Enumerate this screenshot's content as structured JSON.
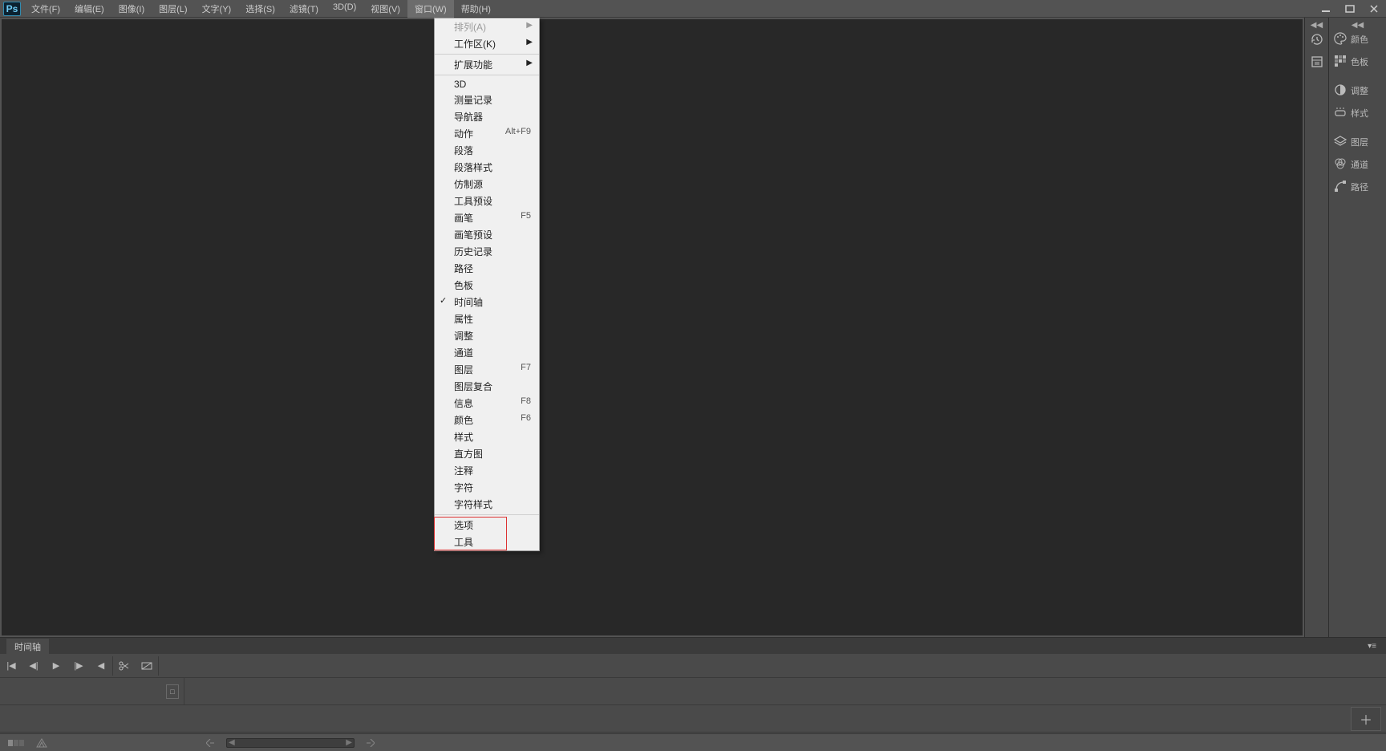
{
  "app": {
    "logo": "Ps"
  },
  "menu": {
    "items": [
      "文件(F)",
      "编辑(E)",
      "图像(I)",
      "图层(L)",
      "文字(Y)",
      "选择(S)",
      "滤镜(T)",
      "3D(D)",
      "视图(V)",
      "窗口(W)",
      "帮助(H)"
    ],
    "active_index": 9
  },
  "window_dropdown": {
    "sections": [
      [
        {
          "label": "排列(A)",
          "submenu": true,
          "disabled": true
        },
        {
          "label": "工作区(K)",
          "submenu": true
        }
      ],
      [
        {
          "label": "扩展功能",
          "submenu": true
        }
      ],
      [
        {
          "label": "3D"
        },
        {
          "label": "测量记录"
        },
        {
          "label": "导航器"
        },
        {
          "label": "动作",
          "shortcut": "Alt+F9"
        },
        {
          "label": "段落"
        },
        {
          "label": "段落样式"
        },
        {
          "label": "仿制源"
        },
        {
          "label": "工具预设"
        },
        {
          "label": "画笔",
          "shortcut": "F5"
        },
        {
          "label": "画笔预设"
        },
        {
          "label": "历史记录"
        },
        {
          "label": "路径"
        },
        {
          "label": "色板"
        },
        {
          "label": "时间轴",
          "checked": true
        },
        {
          "label": "属性"
        },
        {
          "label": "调整"
        },
        {
          "label": "通道"
        },
        {
          "label": "图层",
          "shortcut": "F7"
        },
        {
          "label": "图层复合"
        },
        {
          "label": "信息",
          "shortcut": "F8"
        },
        {
          "label": "颜色",
          "shortcut": "F6"
        },
        {
          "label": "样式"
        },
        {
          "label": "直方图"
        },
        {
          "label": "注释"
        },
        {
          "label": "字符"
        },
        {
          "label": "字符样式"
        }
      ],
      [
        {
          "label": "选项",
          "highlighted": true
        },
        {
          "label": "工具",
          "highlighted": true
        }
      ]
    ]
  },
  "right_panels": {
    "groups": [
      [
        {
          "name": "color",
          "label": "颜色"
        },
        {
          "name": "swatches",
          "label": "色板"
        }
      ],
      [
        {
          "name": "adjustments",
          "label": "调整"
        },
        {
          "name": "styles",
          "label": "样式"
        }
      ],
      [
        {
          "name": "layers",
          "label": "图层"
        },
        {
          "name": "channels",
          "label": "通道"
        },
        {
          "name": "paths",
          "label": "路径"
        }
      ]
    ]
  },
  "timeline": {
    "tab_label": "时间轴"
  }
}
